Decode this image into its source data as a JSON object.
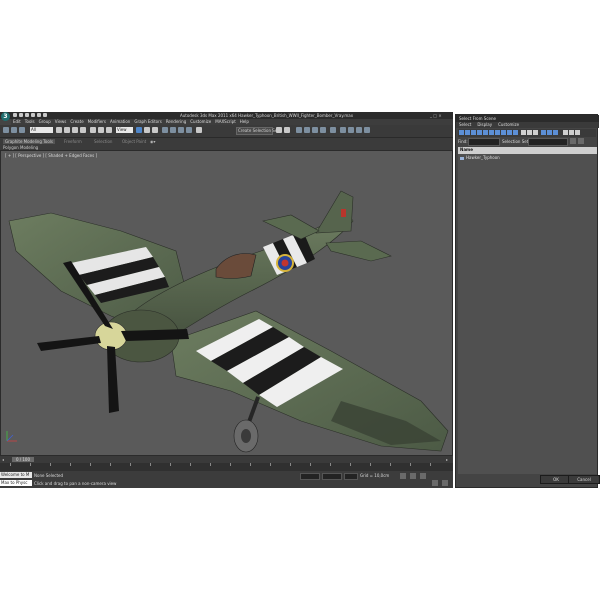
{
  "window": {
    "title": "Autodesk 3ds Max 2011 x64    Hawker_Typhoon_British_WWII_Fighter_Bomber_Vray.max",
    "logo_letter": "3",
    "menu": [
      "Edit",
      "Tools",
      "Group",
      "Views",
      "Create",
      "Modifiers",
      "Animation",
      "Graph Editors",
      "Rendering",
      "Customize",
      "MAXScript",
      "Help"
    ]
  },
  "toolbar": {
    "selection_filter": "All",
    "reference_coord": "View",
    "named_selection": "Create Selection Se"
  },
  "ribbon": {
    "tabs": [
      "Graphite Modeling Tools",
      "Freeform",
      "Selection",
      "Object Paint"
    ],
    "panel_label": "Polygon Modeling"
  },
  "viewport": {
    "label": "[ + ] [ Perspective ] [ Shaded + Edged Faces ]"
  },
  "timeline": {
    "frame": "0 / 100"
  },
  "status": {
    "welcome": "Welcome to M",
    "maxscript": "Max to Physc",
    "selected": "None Selected",
    "prompt": "Click and drag to pan a non-camera view",
    "grid": "Grid = 10,0cm"
  },
  "dialog": {
    "title": "Select From Scene",
    "menu": [
      "Select",
      "Display",
      "Customize"
    ],
    "find_label": "Find:",
    "selection_set_label": "Selection Set:",
    "column_name": "Name",
    "objects": [
      "Hawker_Typhoon"
    ],
    "ok_label": "OK",
    "cancel_label": "Cancel"
  }
}
